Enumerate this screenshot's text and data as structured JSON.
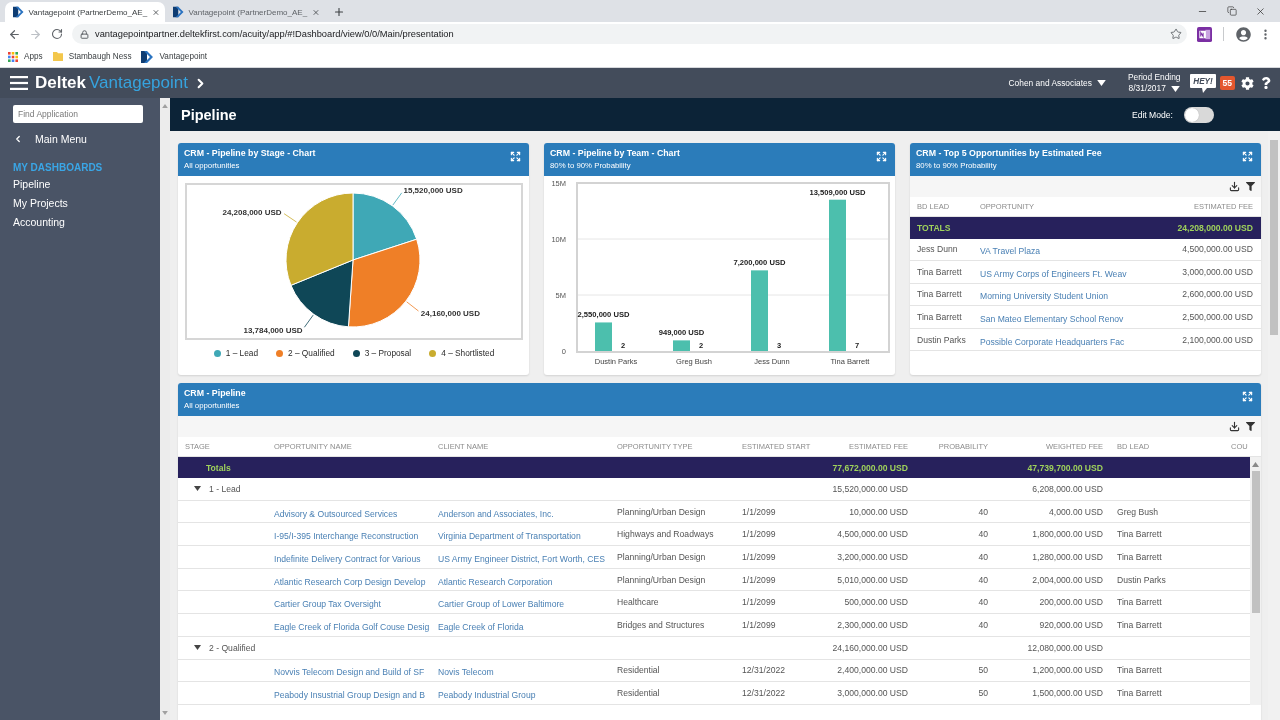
{
  "browser": {
    "tabs": [
      {
        "title": "Vantagepoint (PartnerDemo_AE_",
        "selected": true
      },
      {
        "title": "Vantagepoint (PartnerDemo_AE_",
        "selected": false
      }
    ],
    "url": "vantagepointpartner.deltekfirst.com/acuity/app/#!Dashboard/view/0/0/Main/presentation",
    "bookmarks": [
      {
        "kind": "apps",
        "label": "Apps"
      },
      {
        "kind": "folder",
        "label": "Stambaugh Ness"
      },
      {
        "kind": "site",
        "label": "Vantagepoint"
      }
    ]
  },
  "app_header": {
    "brand": "Deltek",
    "product": "Vantagepoint",
    "company": "Cohen and Associates",
    "period_label": "Period Ending",
    "period_value": "8/31/2017",
    "chat_label": "HEY!",
    "notification_count": "55"
  },
  "sidebar": {
    "search_placeholder": "Find Application",
    "back_label": "Main Menu",
    "section_title": "MY DASHBOARDS",
    "items": [
      "Pipeline",
      "My Projects",
      "Accounting"
    ]
  },
  "page": {
    "title": "Pipeline",
    "edit_mode": {
      "label": "Edit Mode:",
      "on": false
    }
  },
  "stage_chart": {
    "title": "CRM - Pipeline by Stage - Chart",
    "subtitle": "All opportunities",
    "chart_data": {
      "type": "pie",
      "categories": [
        "1 – Lead",
        "2 – Qualified",
        "3 – Proposal",
        "4 – Shortlisted"
      ],
      "values": [
        15520000,
        24160000,
        13784000,
        24208000
      ],
      "colors": [
        "#3fa8b6",
        "#ef7f27",
        "#0f4757",
        "#c9ac2f"
      ],
      "value_labels": [
        "15,520,000 USD",
        "24,160,000 USD",
        "13,784,000 USD",
        "24,208,000 USD"
      ]
    }
  },
  "team_chart": {
    "title": "CRM - Pipeline by Team - Chart",
    "subtitle": "80% to 90% Probability",
    "chart_data": {
      "type": "bar",
      "categories": [
        "Dustin Parks",
        "Greg Bush",
        "Jess Dunn",
        "Tina Barrett"
      ],
      "values": [
        2550000,
        949000,
        7200000,
        13509000
      ],
      "color": "#4cbfad",
      "ylim": [
        0,
        15000000
      ],
      "yticks": [
        {
          "value": 0,
          "label": "0"
        },
        {
          "value": 5000000,
          "label": "5M"
        },
        {
          "value": 10000000,
          "label": "10M"
        },
        {
          "value": 15000000,
          "label": "15M"
        }
      ],
      "value_labels": [
        "2,550,000 USD",
        "949,000 USD",
        "7,200,000 USD",
        "13,509,000 USD"
      ],
      "annotations": [
        "2",
        "2",
        "3",
        "7"
      ],
      "grid": true
    }
  },
  "top_opportunities": {
    "title": "CRM - Top 5 Opportunities by Estimated Fee",
    "subtitle": "80% to 90% Probability",
    "columns": [
      "BD LEAD",
      "OPPORTUNITY",
      "ESTIMATED FEE"
    ],
    "totals": {
      "label": "TOTALS",
      "estimated_fee": "24,208,000.00 USD"
    },
    "rows": [
      {
        "bd_lead": "Jess Dunn",
        "opportunity": "VA Travel Plaza",
        "estimated_fee": "4,500,000.00 USD"
      },
      {
        "bd_lead": "Tina Barrett",
        "opportunity": "US Army Corps of Engineers Ft. Weav",
        "estimated_fee": "3,000,000.00 USD"
      },
      {
        "bd_lead": "Tina Barrett",
        "opportunity": "Morning University Student Union",
        "estimated_fee": "2,600,000.00 USD"
      },
      {
        "bd_lead": "Tina Barrett",
        "opportunity": "San Mateo Elementary School Renov",
        "estimated_fee": "2,500,000.00 USD"
      },
      {
        "bd_lead": "Dustin Parks",
        "opportunity": "Possible Corporate Headquarters Fac",
        "estimated_fee": "2,100,000.00 USD"
      }
    ]
  },
  "pipeline": {
    "title": "CRM - Pipeline",
    "subtitle": "All opportunities",
    "columns": [
      "STAGE",
      "OPPORTUNITY NAME",
      "CLIENT NAME",
      "OPPORTUNITY TYPE",
      "ESTIMATED START",
      "ESTIMATED FEE",
      "PROBABILITY",
      "WEIGHTED FEE",
      "BD LEAD",
      "COU"
    ],
    "totals": {
      "label": "Totals",
      "estimated_fee": "77,672,000.00 USD",
      "weighted_fee": "47,739,700.00 USD"
    },
    "groups": [
      {
        "stage": "1 - Lead",
        "expanded": true,
        "estimated_fee": "15,520,000.00 USD",
        "weighted_fee": "6,208,000.00 USD",
        "rows": [
          {
            "opportunity": "Advisory & Outsourced Services",
            "client": "Anderson and Associates, Inc.",
            "type": "Planning/Urban Design",
            "start": "1/1/2099",
            "estimated_fee": "10,000.00 USD",
            "probability": "40",
            "weighted_fee": "4,000.00 USD",
            "bd_lead": "Greg Bush"
          },
          {
            "opportunity": "I-95/I-395 Interchange Reconstruction",
            "client": "Virginia Department of Transportation",
            "type": "Highways and Roadways",
            "start": "1/1/2099",
            "estimated_fee": "4,500,000.00 USD",
            "probability": "40",
            "weighted_fee": "1,800,000.00 USD",
            "bd_lead": "Tina Barrett"
          },
          {
            "opportunity": "Indefinite Delivery Contract for Various",
            "client": "US Army Engineer District, Fort Worth, CES",
            "type": "Planning/Urban Design",
            "start": "1/1/2099",
            "estimated_fee": "3,200,000.00 USD",
            "probability": "40",
            "weighted_fee": "1,280,000.00 USD",
            "bd_lead": "Tina Barrett"
          },
          {
            "opportunity": "Atlantic Research Corp Design Develop",
            "client": "Atlantic Research Corporation",
            "type": "Planning/Urban Design",
            "start": "1/1/2099",
            "estimated_fee": "5,010,000.00 USD",
            "probability": "40",
            "weighted_fee": "2,004,000.00 USD",
            "bd_lead": "Dustin Parks"
          },
          {
            "opportunity": "Cartier Group Tax Oversight",
            "client": "Cartier Group of Lower Baltimore",
            "type": "Healthcare",
            "start": "1/1/2099",
            "estimated_fee": "500,000.00 USD",
            "probability": "40",
            "weighted_fee": "200,000.00 USD",
            "bd_lead": "Tina Barrett"
          },
          {
            "opportunity": "Eagle Creek of Florida Golf Couse Desig",
            "client": "Eagle Creek of Florida",
            "type": "Bridges and Structures",
            "start": "1/1/2099",
            "estimated_fee": "2,300,000.00 USD",
            "probability": "40",
            "weighted_fee": "920,000.00 USD",
            "bd_lead": "Tina Barrett"
          }
        ]
      },
      {
        "stage": "2 - Qualified",
        "expanded": true,
        "estimated_fee": "24,160,000.00 USD",
        "weighted_fee": "12,080,000.00 USD",
        "rows": [
          {
            "opportunity": "Novvis Telecom Design and Build of SF",
            "client": "Novis Telecom",
            "type": "Residential",
            "start": "12/31/2022",
            "estimated_fee": "2,400,000.00 USD",
            "probability": "50",
            "weighted_fee": "1,200,000.00 USD",
            "bd_lead": "Tina Barrett"
          },
          {
            "opportunity": "Peabody Insustrial Group Design and B",
            "client": "Peabody Industrial Group",
            "type": "Residential",
            "start": "12/31/2022",
            "estimated_fee": "3,000,000.00 USD",
            "probability": "50",
            "weighted_fee": "1,500,000.00 USD",
            "bd_lead": "Tina Barrett"
          }
        ]
      }
    ]
  }
}
